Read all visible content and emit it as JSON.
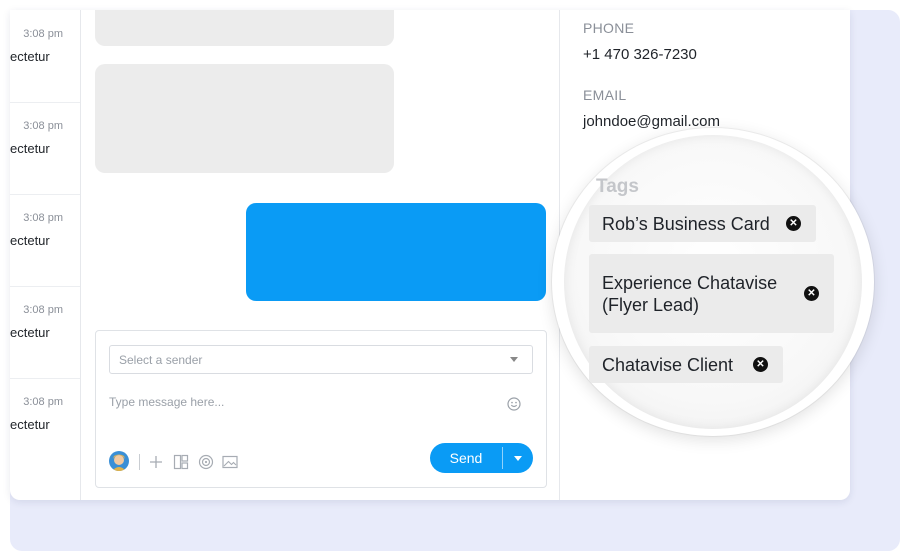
{
  "conversations": [
    {
      "time": "3:08 pm",
      "preview": "ectetur"
    },
    {
      "time": "3:08 pm",
      "preview": "ectetur"
    },
    {
      "time": "3:08 pm",
      "preview": "ectetur"
    },
    {
      "time": "3:08 pm",
      "preview": "ectetur"
    },
    {
      "time": "3:08 pm",
      "preview": "ectetur"
    }
  ],
  "composer": {
    "sender_placeholder": "Select a sender",
    "message_placeholder": "Type message here...",
    "send_label": "Send",
    "tool_icons": [
      "plus-icon",
      "template-icon",
      "target-icon",
      "image-icon"
    ]
  },
  "contact": {
    "phone_label": "PHONE",
    "phone": "+1 470 326-7230",
    "email_label": "EMAIL",
    "email": "johndoe@gmail.com",
    "tags_label": "Tags",
    "tags": [
      {
        "label": "Rob’s Business Card"
      },
      {
        "label": "Experience Chatavise (Flyer Lead)"
      },
      {
        "label": "Chatavise Client"
      }
    ]
  },
  "colors": {
    "accent": "#0a9bf5",
    "incoming_bubble": "#ececec",
    "backdrop": "#e8ebfa"
  }
}
